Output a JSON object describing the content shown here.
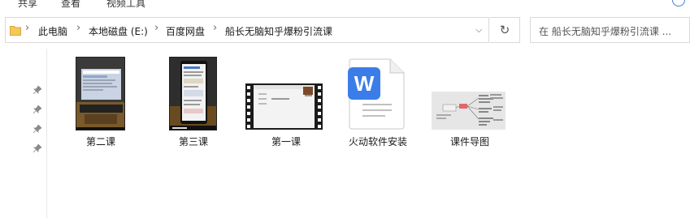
{
  "ribbon": {
    "tabs": [
      "共享",
      "查看",
      "视频工具"
    ]
  },
  "address_bar": {
    "breadcrumbs": [
      "此电脑",
      "本地磁盘 (E:)",
      "百度网盘",
      "船长无脑知乎爆粉引流课"
    ],
    "refresh_icon": "refresh-icon",
    "dropdown_icon": "chevron-down-icon"
  },
  "search": {
    "placeholder": "在 船长无脑知乎爆粉引流课 ..."
  },
  "nav": {
    "pins": 4
  },
  "files": [
    {
      "name": "第二课",
      "type": "video"
    },
    {
      "name": "第三课",
      "type": "video"
    },
    {
      "name": "第一课",
      "type": "video"
    },
    {
      "name": "火动软件安装",
      "type": "wps-document"
    },
    {
      "name": "课件导图",
      "type": "image"
    }
  ],
  "colors": {
    "wps_blue": "#3b7de8",
    "folder_yellow": "#f4c85a",
    "film_black": "#1b1b1b"
  }
}
